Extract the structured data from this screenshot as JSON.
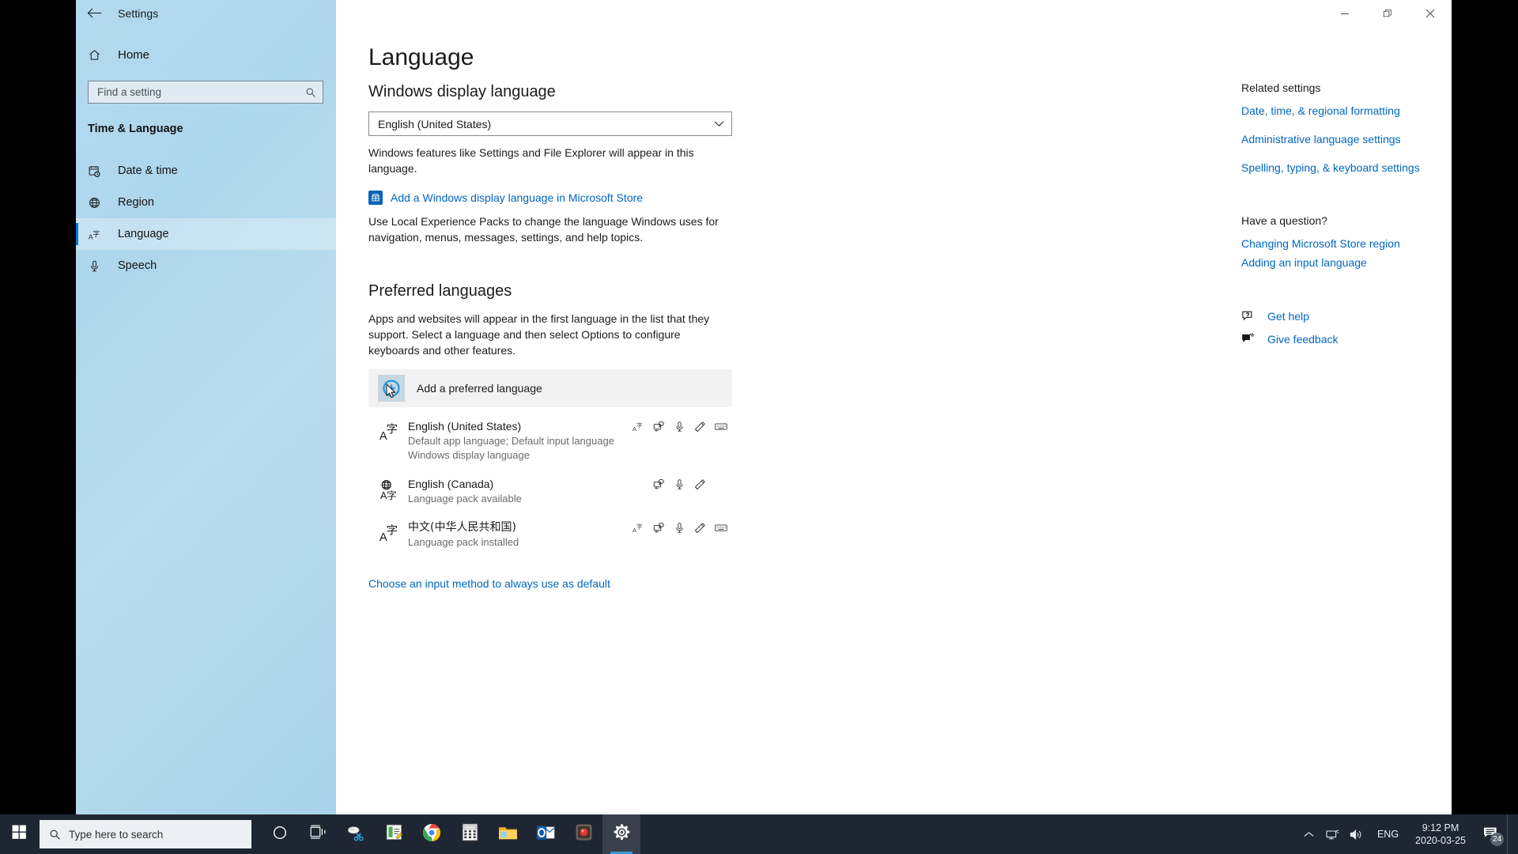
{
  "window": {
    "app_title": "Settings",
    "back_icon": "back-arrow-icon",
    "minimize_label": "–",
    "maximize_label": "❐",
    "close_label": "✕"
  },
  "sidebar": {
    "home_label": "Home",
    "home_icon": "home-icon",
    "search": {
      "placeholder": "Find a setting",
      "value": "",
      "icon": "search-icon"
    },
    "group_title": "Time & Language",
    "items": [
      {
        "label": "Date & time",
        "icon": "calendar-clock-icon",
        "selected": false
      },
      {
        "label": "Region",
        "icon": "globe-icon",
        "selected": false
      },
      {
        "label": "Language",
        "icon": "language-icon",
        "selected": true
      },
      {
        "label": "Speech",
        "icon": "microphone-icon",
        "selected": false
      }
    ]
  },
  "main": {
    "page_title": "Language",
    "display_language": {
      "heading": "Windows display language",
      "selected": "English (United States)",
      "chevron_icon": "chevron-down-icon",
      "description": "Windows features like Settings and File Explorer will appear in this language.",
      "store_link": "Add a Windows display language in Microsoft Store",
      "store_icon": "microsoft-store-icon",
      "lep_description": "Use Local Experience Packs to change the language Windows uses for navigation, menus, messages, settings, and help topics."
    },
    "preferred_languages": {
      "heading": "Preferred languages",
      "description": "Apps and websites will appear in the first language in the list that they support. Select a language and then select Options to configure keyboards and other features.",
      "add_button_label": "Add a preferred language",
      "add_button_icon": "add-circle-icon",
      "languages": [
        {
          "name": "English (United States)",
          "icon": "language-az-icon",
          "sublines": [
            "Default app language; Default input language",
            "Windows display language"
          ],
          "features": [
            "display-language-icon",
            "text-to-speech-icon",
            "speech-recognition-icon",
            "handwriting-icon",
            "keyboard-icon"
          ]
        },
        {
          "name": "English (Canada)",
          "icon": "language-globe-icon",
          "sublines": [
            "Language pack available"
          ],
          "features": [
            "text-to-speech-icon",
            "speech-recognition-icon",
            "handwriting-icon"
          ]
        },
        {
          "name": "中文(中华人民共和国)",
          "icon": "language-az-icon",
          "sublines": [
            "Language pack installed"
          ],
          "features": [
            "display-language-icon",
            "text-to-speech-icon",
            "speech-recognition-icon",
            "handwriting-icon",
            "keyboard-icon"
          ]
        }
      ],
      "default_input_link": "Choose an input method to always use as default"
    }
  },
  "rail": {
    "related_heading": "Related settings",
    "related_links": [
      "Date, time, & regional formatting",
      "Administrative language settings",
      "Spelling, typing, & keyboard settings"
    ],
    "question_heading": "Have a question?",
    "question_links": [
      "Changing Microsoft Store region",
      "Adding an input language"
    ],
    "get_help": {
      "label": "Get help",
      "icon": "help-question-icon"
    },
    "give_feedback": {
      "label": "Give feedback",
      "icon": "feedback-icon"
    }
  },
  "taskbar": {
    "start_icon": "windows-start-icon",
    "search": {
      "placeholder": "Type here to search",
      "icon": "search-icon"
    },
    "pinned": [
      {
        "name": "cortana-icon"
      },
      {
        "name": "task-view-icon"
      },
      {
        "name": "snip-sketch-icon"
      },
      {
        "name": "sticky-notes-icon"
      },
      {
        "name": "google-chrome-icon"
      },
      {
        "name": "calculator-icon"
      },
      {
        "name": "file-explorer-icon"
      },
      {
        "name": "outlook-icon"
      },
      {
        "name": "screen-recorder-icon"
      },
      {
        "name": "settings-gear-icon",
        "active": true
      }
    ],
    "tray": {
      "chevron_icon": "chevron-up-icon",
      "network_icon": "network-icon",
      "volume_icon": "volume-icon",
      "language": "ENG",
      "time": "9:12 PM",
      "date": "2020-03-25",
      "notifications_icon": "notification-icon",
      "notifications_count": "24"
    }
  },
  "colors": {
    "accent": "#0078d4",
    "link": "#0067c0",
    "taskbar": "#1f2633",
    "sidebar": "#b3d9ef"
  }
}
